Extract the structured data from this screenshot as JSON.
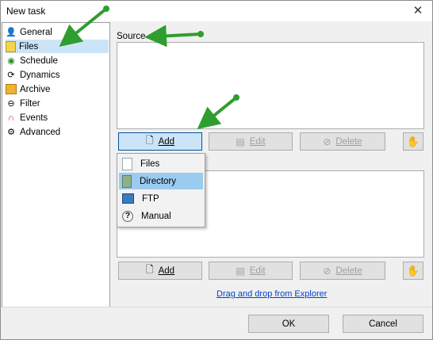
{
  "window": {
    "title": "New task"
  },
  "sidebar": {
    "items": [
      {
        "label": "General",
        "icon": "general-icon"
      },
      {
        "label": "Files",
        "icon": "files-icon"
      },
      {
        "label": "Schedule",
        "icon": "schedule-icon"
      },
      {
        "label": "Dynamics",
        "icon": "dynamics-icon"
      },
      {
        "label": "Archive",
        "icon": "archive-icon"
      },
      {
        "label": "Filter",
        "icon": "filter-icon"
      },
      {
        "label": "Events",
        "icon": "events-icon"
      },
      {
        "label": "Advanced",
        "icon": "advanced-icon"
      }
    ],
    "selected": "Files"
  },
  "source": {
    "label": "Source",
    "buttons": {
      "add": "Add",
      "edit": "Edit",
      "delete": "Delete"
    }
  },
  "destination": {
    "buttons": {
      "add": "Add",
      "edit": "Edit",
      "delete": "Delete"
    }
  },
  "add_menu": {
    "items": [
      {
        "label": "Files",
        "icon": "file-icon"
      },
      {
        "label": "Directory",
        "icon": "folder-icon"
      },
      {
        "label": "FTP",
        "icon": "ftp-icon"
      },
      {
        "label": "Manual",
        "icon": "help-icon"
      }
    ],
    "highlighted": "Directory"
  },
  "drag_drop_link": "Drag and drop from Explorer",
  "footer": {
    "ok": "OK",
    "cancel": "Cancel"
  },
  "colors": {
    "arrow": "#2e9e2e",
    "selection": "#cce4f7",
    "menu_highlight": "#9ccbf0",
    "link": "#0044cc"
  }
}
